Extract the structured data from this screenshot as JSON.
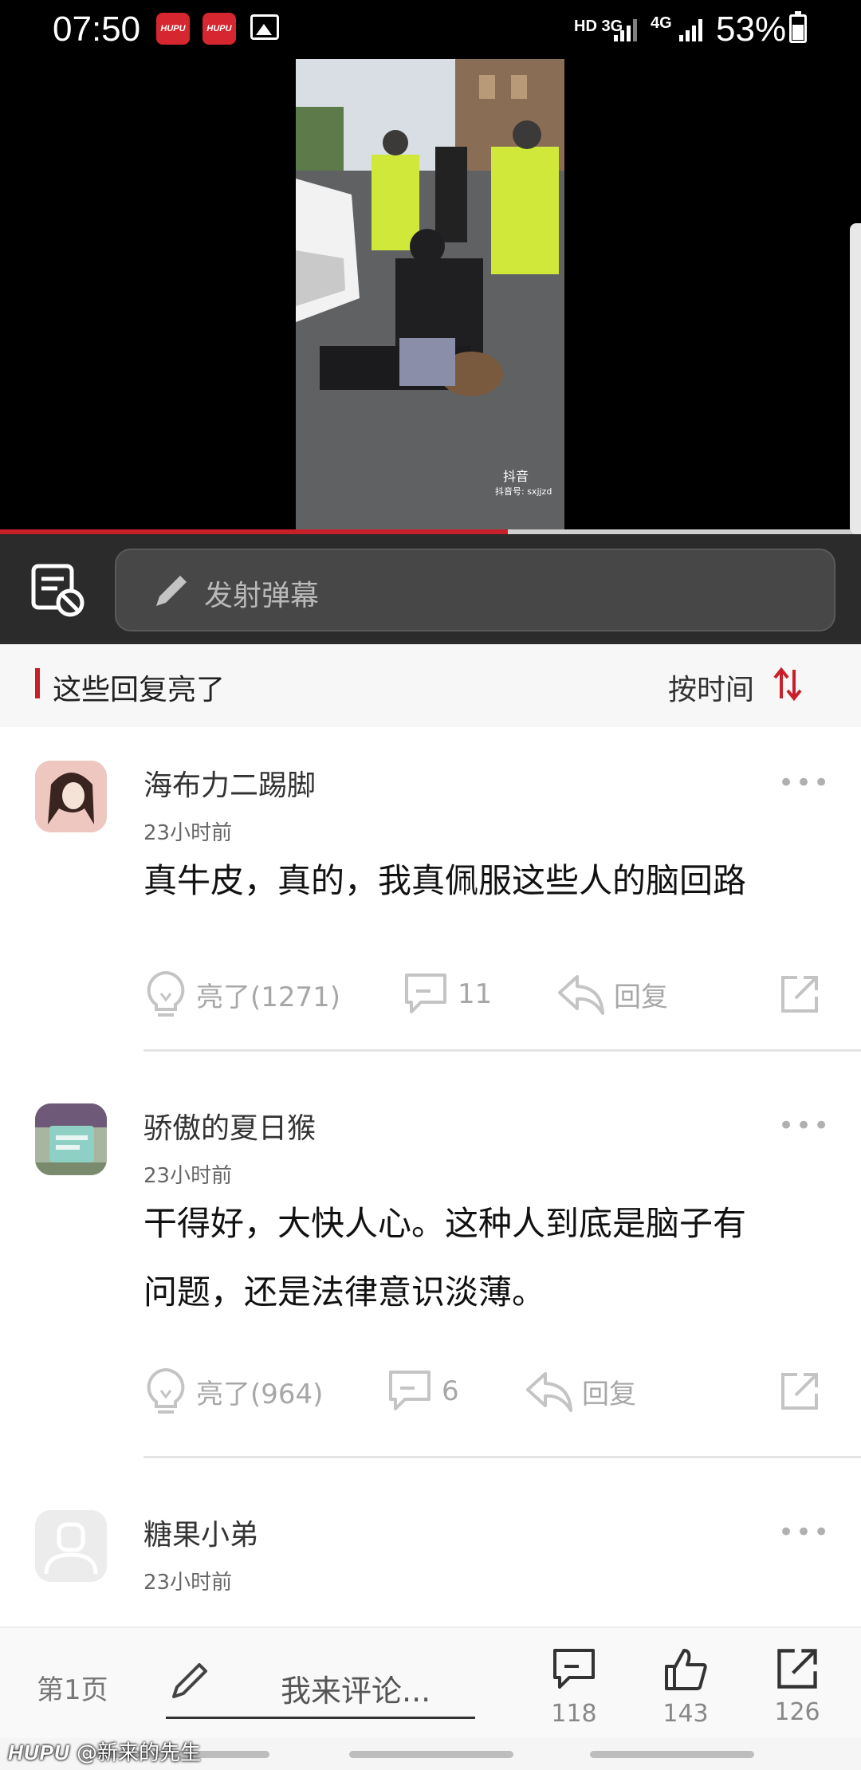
{
  "status_bar": {
    "time": "07:50",
    "badges": [
      "HUPU",
      "HUPU"
    ],
    "network_1": "HD 3G",
    "network_2": "4G",
    "battery": "53%"
  },
  "video": {
    "overlay_brand": "抖音",
    "overlay_id": "抖音号: sxjjzd",
    "progress": 0.59
  },
  "danmaku": {
    "placeholder": "发射弹幕",
    "toggle_icon": "danmaku-off-icon"
  },
  "section": {
    "title": "这些回复亮了",
    "sort_label": "按时间",
    "accent": "#c8202a"
  },
  "comments": [
    {
      "username": "海布力二踢脚",
      "time": "23小时前",
      "text": "真牛皮，真的，我真佩服这些人的脑回路",
      "light_label": "亮了(1271)",
      "reply_count": "11",
      "reply_label": "回复"
    },
    {
      "username": "骄傲的夏日猴",
      "time": "23小时前",
      "text_line1": "干得好，大快人心。这种人到底是脑子有",
      "text_line2": "问题，还是法律意识淡薄。",
      "light_label": "亮了(964)",
      "reply_count": "6",
      "reply_label": "回复"
    },
    {
      "username": "糖果小弟",
      "time": "23小时前"
    }
  ],
  "bottom_bar": {
    "page_label": "第1页",
    "comment_placeholder": "我来评论...",
    "comments_count": "118",
    "likes_count": "143",
    "shares_count": "126"
  },
  "watermark": {
    "logo": "HUPU",
    "handle": "@新来的先生"
  }
}
